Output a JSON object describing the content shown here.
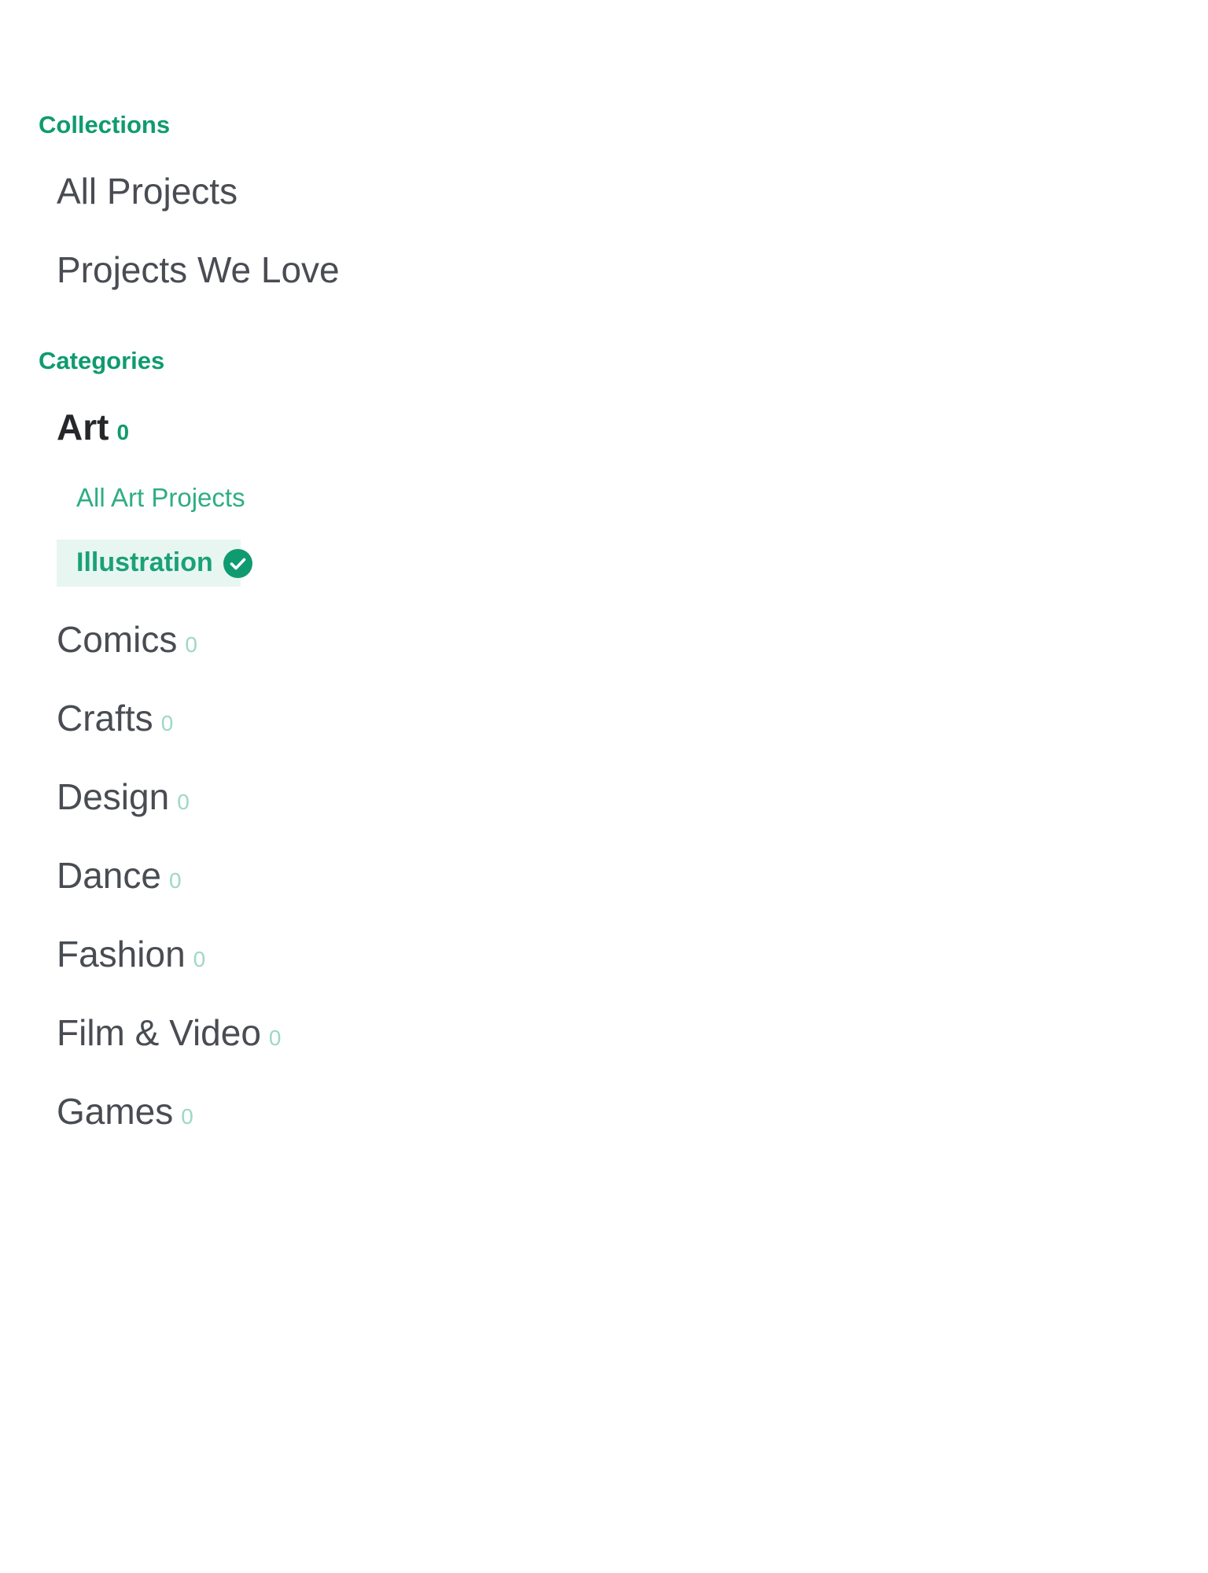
{
  "collections": {
    "heading": "Collections",
    "items": [
      {
        "label": "All Projects"
      },
      {
        "label": "Projects We Love"
      }
    ]
  },
  "categories": {
    "heading": "Categories",
    "active": {
      "label": "Art",
      "count": "0",
      "subitems": [
        {
          "label": "All Art Projects"
        },
        {
          "label": "Illustration",
          "selected": true
        }
      ]
    },
    "items": [
      {
        "label": "Comics",
        "count": "0"
      },
      {
        "label": "Crafts",
        "count": "0"
      },
      {
        "label": "Design",
        "count": "0"
      },
      {
        "label": "Dance",
        "count": "0"
      },
      {
        "label": "Fashion",
        "count": "0"
      },
      {
        "label": "Film & Video",
        "count": "0"
      },
      {
        "label": "Games",
        "count": "0"
      }
    ]
  },
  "colors": {
    "accent": "#0f9b6f",
    "count_muted": "#9ed8c4",
    "selected_bg": "#e8f6f1",
    "text": "#494c52"
  },
  "icons": {
    "selected_indicator": "check-circle-icon"
  }
}
